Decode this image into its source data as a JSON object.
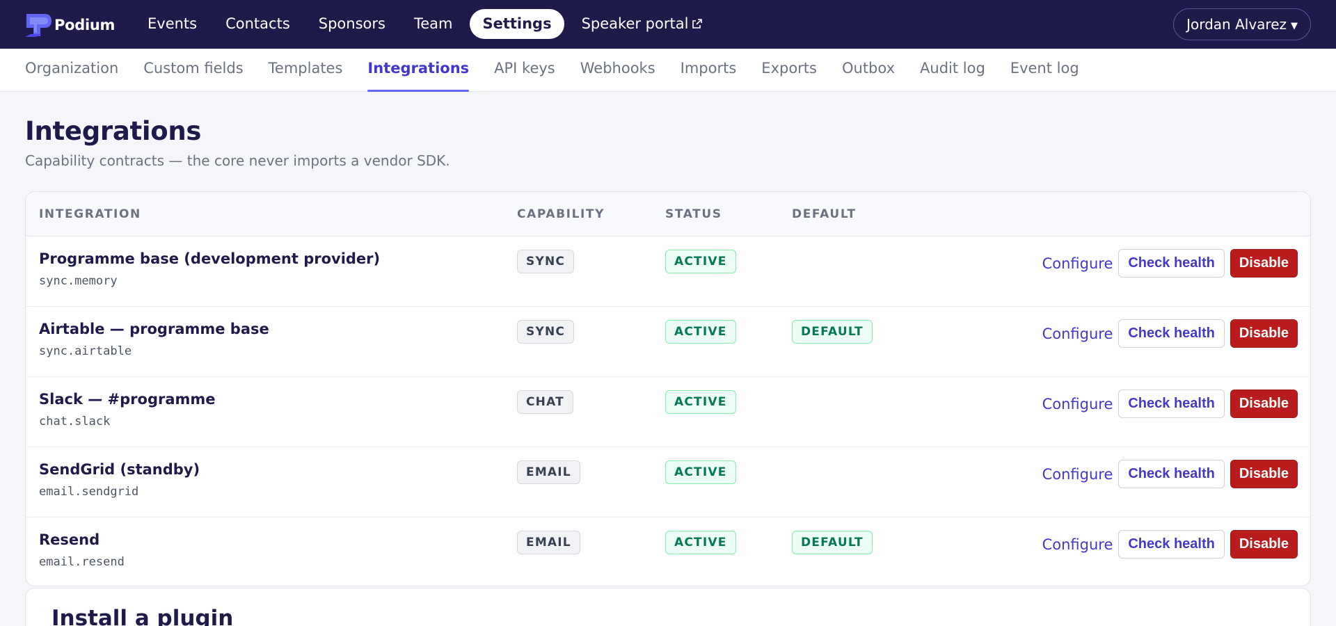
{
  "app": {
    "brand_name": "Podium",
    "colors": {
      "nav_bg": "#1e1b4b",
      "accent": "#4338ca",
      "danger": "#b91c1c",
      "success": "#047857"
    }
  },
  "topnav": {
    "items": [
      {
        "label": "Events"
      },
      {
        "label": "Contacts"
      },
      {
        "label": "Sponsors"
      },
      {
        "label": "Team"
      },
      {
        "label": "Settings",
        "active": true
      },
      {
        "label": "Speaker portal",
        "icon": "external-link-icon"
      }
    ],
    "user_name": "Jordan Alvarez"
  },
  "subnav": {
    "tabs": [
      {
        "label": "Organization"
      },
      {
        "label": "Custom fields"
      },
      {
        "label": "Templates"
      },
      {
        "label": "Integrations",
        "active": true
      },
      {
        "label": "API keys"
      },
      {
        "label": "Webhooks"
      },
      {
        "label": "Imports"
      },
      {
        "label": "Exports"
      },
      {
        "label": "Outbox"
      },
      {
        "label": "Audit log"
      },
      {
        "label": "Event log"
      }
    ]
  },
  "page": {
    "title": "Integrations",
    "subtitle": "Capability contracts — the core never imports a vendor SDK."
  },
  "table": {
    "columns": {
      "integration": "INTEGRATION",
      "capability": "CAPABILITY",
      "status": "STATUS",
      "default": "DEFAULT"
    },
    "actions": {
      "configure": "Configure",
      "check_health": "Check health",
      "disable": "Disable"
    },
    "rows": [
      {
        "name": "Programme base (development provider)",
        "key": "sync.memory",
        "capability": "SYNC",
        "status": "ACTIVE",
        "default": ""
      },
      {
        "name": "Airtable — programme base",
        "key": "sync.airtable",
        "capability": "SYNC",
        "status": "ACTIVE",
        "default": "DEFAULT"
      },
      {
        "name": "Slack — #programme",
        "key": "chat.slack",
        "capability": "CHAT",
        "status": "ACTIVE",
        "default": ""
      },
      {
        "name": "SendGrid (standby)",
        "key": "email.sendgrid",
        "capability": "EMAIL",
        "status": "ACTIVE",
        "default": ""
      },
      {
        "name": "Resend",
        "key": "email.resend",
        "capability": "EMAIL",
        "status": "ACTIVE",
        "default": "DEFAULT"
      }
    ]
  },
  "plugin": {
    "title": "Install a plugin"
  }
}
